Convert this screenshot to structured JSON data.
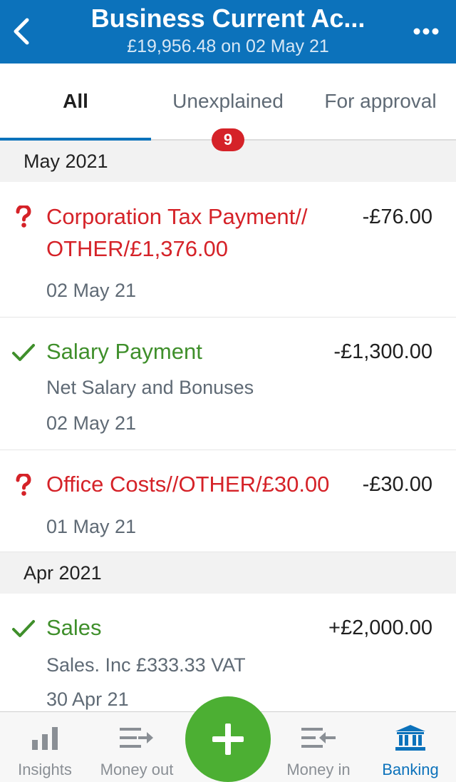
{
  "header": {
    "title": "Business Current Ac...",
    "subtitle": "£19,956.48 on 02 May 21",
    "back_icon": "chevron-left-icon",
    "more_icon": "more-dots-icon"
  },
  "tabs": [
    {
      "label": "All",
      "active": true
    },
    {
      "label": "Unexplained",
      "badge": "9"
    },
    {
      "label": "For approval"
    }
  ],
  "sections": [
    {
      "label": "May 2021",
      "transactions": [
        {
          "status": "unexplained",
          "title_line1": "Corporation Tax Payment//",
          "title_line2": "OTHER/£1,376.00",
          "amount": "-£76.00",
          "date": "02 May 21"
        },
        {
          "status": "explained",
          "title": "Salary Payment",
          "subtitle": "Net Salary and Bonuses",
          "amount": "-£1,300.00",
          "date": "02 May 21"
        },
        {
          "status": "unexplained",
          "title": "Office Costs//OTHER/£30.00",
          "amount": "-£30.00",
          "date": "01 May 21"
        }
      ]
    },
    {
      "label": "Apr 2021",
      "transactions": [
        {
          "status": "explained",
          "title": "Sales",
          "subtitle": "Sales. Inc £333.33 VAT",
          "amount": "+£2,000.00",
          "date": "30 Apr 21"
        }
      ]
    }
  ],
  "bottom_nav": [
    {
      "label": "Insights",
      "icon": "bar-chart-icon"
    },
    {
      "label": "Money out",
      "icon": "money-out-icon"
    },
    {
      "label": "Money in",
      "icon": "money-in-icon"
    },
    {
      "label": "Banking",
      "icon": "bank-icon",
      "active": true
    }
  ],
  "fab": {
    "icon": "plus-icon"
  },
  "colors": {
    "brand": "#0c72bb",
    "unexplained": "#d52228",
    "explained": "#3f8f2b",
    "fab": "#4caf33"
  }
}
